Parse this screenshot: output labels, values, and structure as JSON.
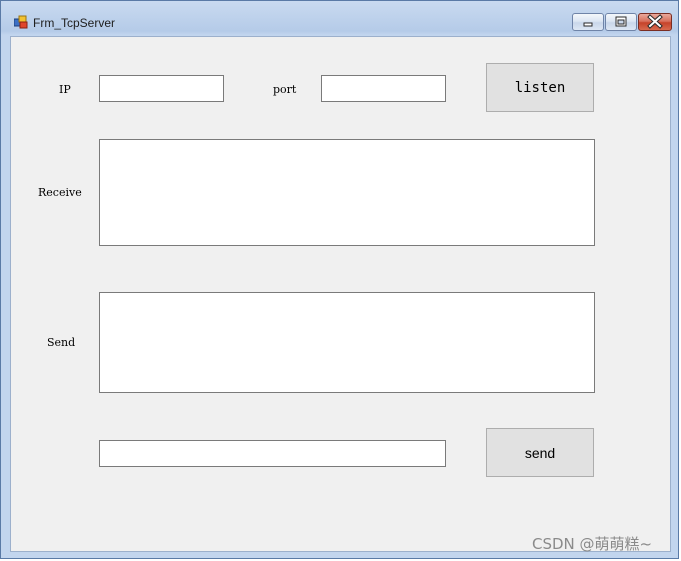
{
  "window": {
    "title": "Frm_TcpServer",
    "icon": "winforms-app-icon"
  },
  "title_controls": {
    "minimize": "minimize-icon",
    "maximize": "maximize-icon",
    "close": "close-icon"
  },
  "form": {
    "ip_label": "IP",
    "ip_value": "",
    "port_label": "port",
    "port_value": "",
    "listen_label": "listen",
    "receive_label": "Receive",
    "receive_value": "",
    "send_label": "Send",
    "send_area_value": "",
    "send_input_value": "",
    "send_button_label": "send"
  },
  "watermark": "CSDN @萌萌糕~"
}
